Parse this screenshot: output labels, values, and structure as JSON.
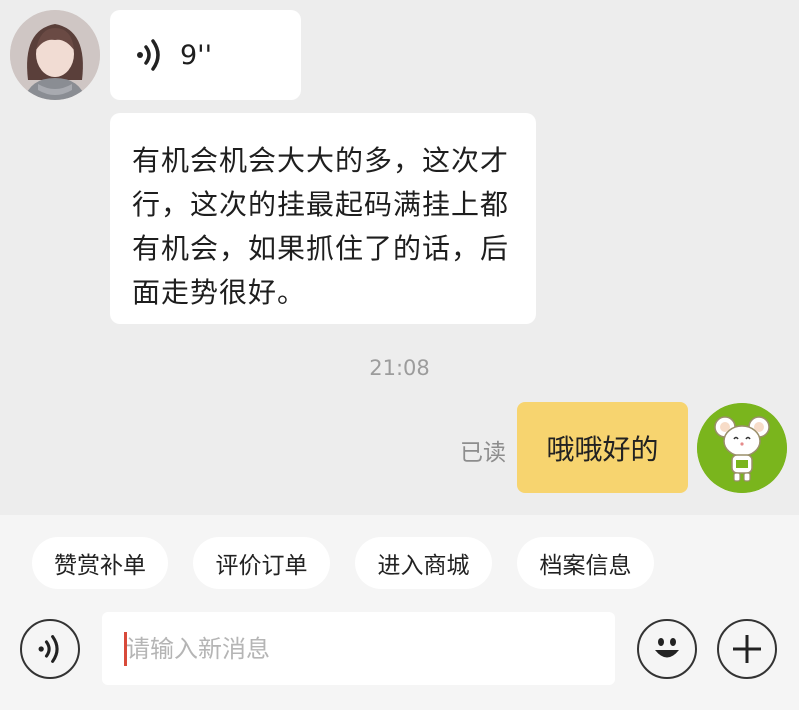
{
  "messages": {
    "voice_duration": "9''",
    "text": "有机会机会大大的多，这次才行，这次的挂最起码满挂上都有机会，如果抓住了的话，后面走势很好。",
    "timestamp": "21:08",
    "read_status": "已读",
    "my_reply": "哦哦好的"
  },
  "quick_replies": [
    "赞赏补单",
    "评价订单",
    "进入商城",
    "档案信息"
  ],
  "input": {
    "placeholder": "请输入新消息",
    "value": ""
  },
  "colors": {
    "my_bubble": "#f7d46f",
    "caret": "#d84a3a",
    "mascot_bg": "#7ab51d"
  },
  "icons": [
    "voice-icon",
    "emoji-icon",
    "plus-icon"
  ]
}
